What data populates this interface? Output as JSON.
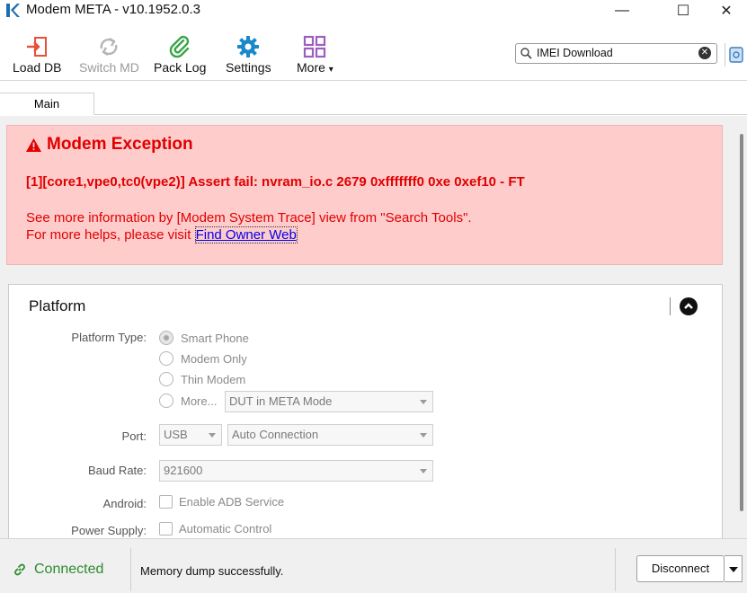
{
  "window": {
    "title": "Modem META - v10.1952.0.3",
    "minimize": "—",
    "maximize": "☐",
    "close": "✕"
  },
  "toolbar": {
    "load_db": "Load DB",
    "switch_md": "Switch MD",
    "pack_log": "Pack Log",
    "settings": "Settings",
    "more": "More",
    "more_arrow": "▾"
  },
  "search": {
    "value": "IMEI Download",
    "clear": "✕"
  },
  "tabs": [
    {
      "label": "Main"
    }
  ],
  "exception": {
    "title": "Modem Exception",
    "detail": "[1][core1,vpe0,tc0(vpe2)] Assert fail: nvram_io.c 2679 0xfffffff0 0xe 0xef10 - FT",
    "info_line1": "See more information by [Modem System Trace] view from \"Search Tools\".",
    "info_line2_prefix": "For more helps, please visit ",
    "link": "Find Owner Web"
  },
  "platform": {
    "title": "Platform",
    "platform_type_label": "Platform Type:",
    "options": [
      {
        "label": "Smart Phone",
        "selected": true
      },
      {
        "label": "Modem Only",
        "selected": false
      },
      {
        "label": "Thin Modem",
        "selected": false
      },
      {
        "label": "More...",
        "selected": false
      }
    ],
    "more_combo": "DUT in META Mode",
    "port_label": "Port:",
    "port_value": "USB",
    "connection_value": "Auto Connection",
    "baud_label": "Baud Rate:",
    "baud_value": "921600",
    "android_label": "Android:",
    "android_checkbox": "Enable ADB Service",
    "power_label": "Power Supply:",
    "power_checkbox": "Automatic Control"
  },
  "status": {
    "connection": "Connected",
    "message": "Memory dump successfully.",
    "disconnect": "Disconnect"
  },
  "colors": {
    "error_red": "#e00000",
    "exception_bg": "#ffcccc",
    "connected_green": "#2e8b2e",
    "link_blue": "#0000ee"
  }
}
